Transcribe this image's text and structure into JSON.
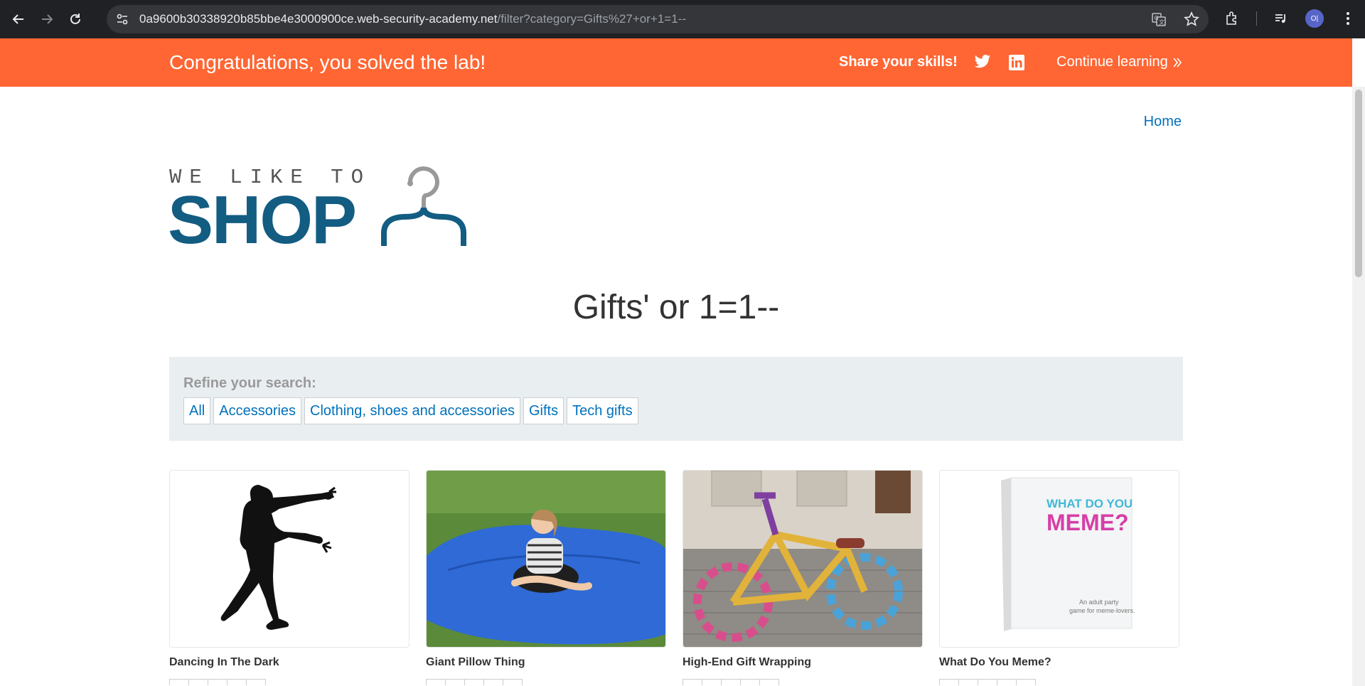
{
  "browser": {
    "url_host": "0a9600b30338920b85bbe4e3000900ce.web-security-academy.net",
    "url_path": "/filter?category=Gifts%27+or+1=1--",
    "avatar_initials": "O|"
  },
  "banner": {
    "title": "Congratulations, you solved the lab!",
    "share_label": "Share your skills!",
    "continue_label": "Continue learning",
    "color": "#ff6633"
  },
  "nav": {
    "home_label": "Home"
  },
  "logo": {
    "small_text": "WE LIKE TO",
    "big_text": "SHOP"
  },
  "category_heading": "Gifts' or 1=1--",
  "filter": {
    "label": "Refine your search:",
    "links": [
      "All",
      "Accessories",
      "Clothing, shoes and accessories",
      "Gifts",
      "Tech gifts"
    ]
  },
  "products": [
    {
      "name": "Dancing In The Dark",
      "image": "silhouette-dancer"
    },
    {
      "name": "Giant Pillow Thing",
      "image": "girl-on-blue-beanbag"
    },
    {
      "name": "High-End Gift Wrapping",
      "image": "yarn-wrapped-bicycle"
    },
    {
      "name": "What Do You Meme?",
      "image": "card-game-box",
      "box_title_1": "WHAT DO YOU",
      "box_title_2": "MEME?",
      "box_tagline_1": "An adult party",
      "box_tagline_2": "game for meme-lovers."
    }
  ],
  "colors": {
    "link": "#0071bc",
    "logo_blue": "#135c82"
  }
}
